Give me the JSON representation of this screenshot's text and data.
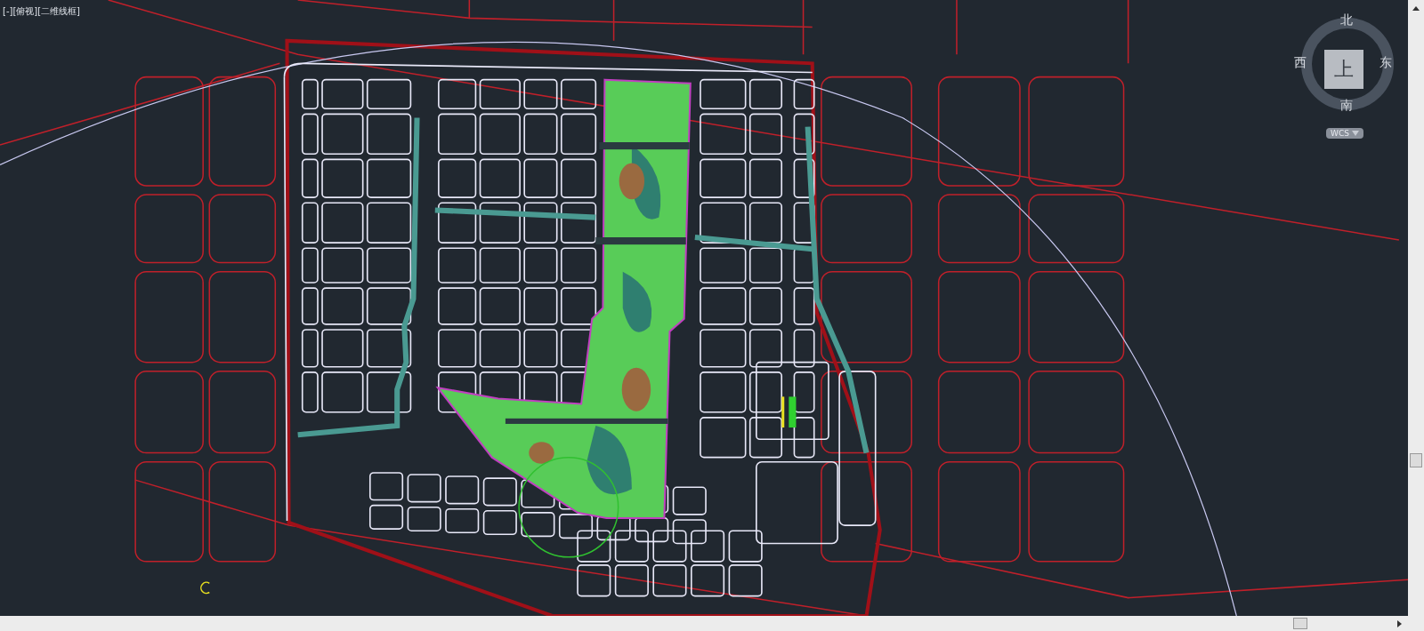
{
  "viewport_label": "[-][俯视][二维线框]",
  "view_cube": {
    "north": "北",
    "west": "西",
    "east": "东",
    "south": "南",
    "face": "上",
    "coordinate_system": "WCS"
  }
}
